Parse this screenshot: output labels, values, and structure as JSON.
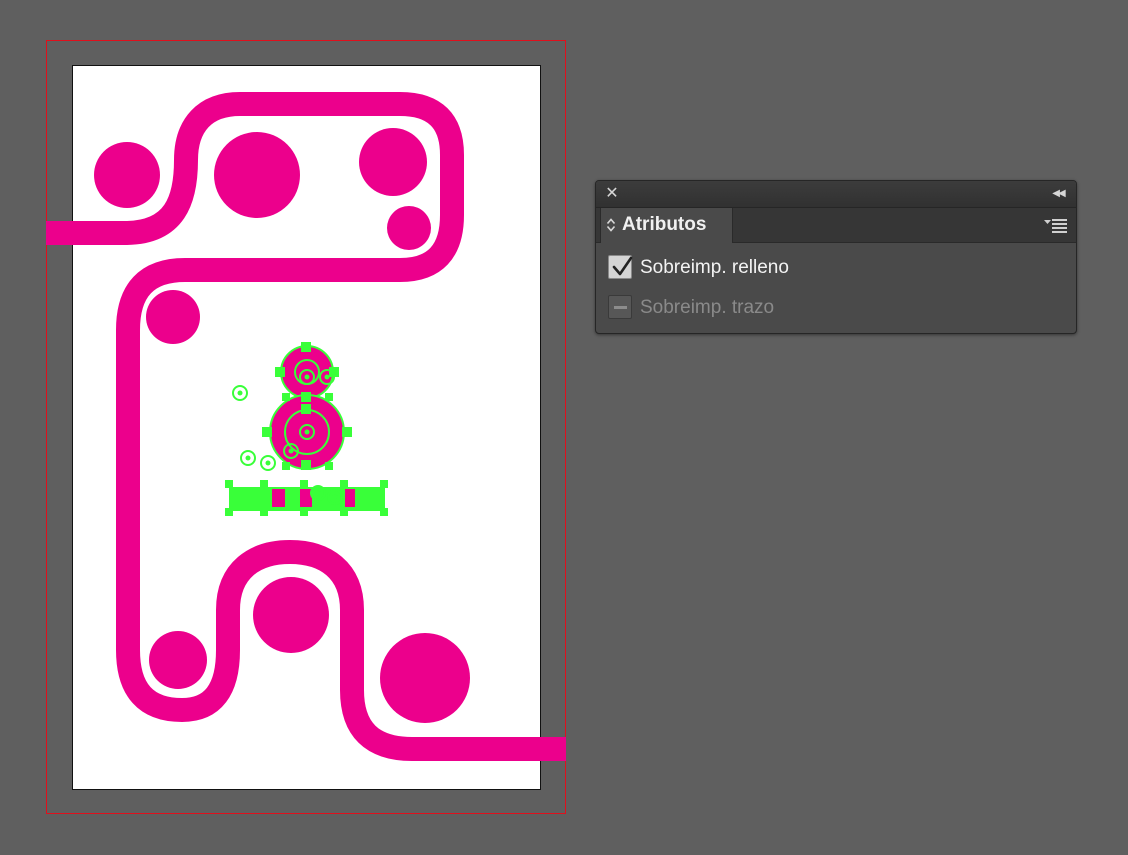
{
  "panel": {
    "tab_label": "Atributos",
    "close_icon": "close-icon",
    "collapse_icon": "double-chevron-left-icon",
    "menu_icon": "panel-menu-icon",
    "options": [
      {
        "label": "Sobreimp. relleno",
        "checked": true,
        "enabled": true
      },
      {
        "label": "Sobreimp. trazo",
        "checked": false,
        "enabled": false
      }
    ]
  },
  "artboard": {
    "artwork_color": "#ec008c",
    "selection_color": "#39ff39",
    "bleed_color": "#e0101c"
  }
}
